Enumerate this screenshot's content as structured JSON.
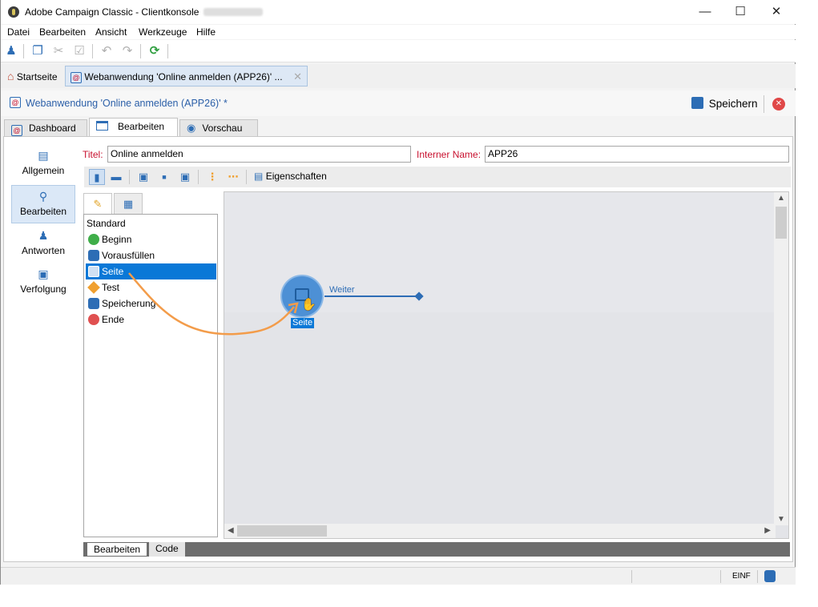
{
  "window": {
    "title": "Adobe Campaign Classic - Clientkonsole"
  },
  "menu": [
    "Datei",
    "Bearbeiten",
    "Ansicht",
    "Werkzeuge",
    "Hilfe"
  ],
  "doc_tabs": {
    "home": "Startseite",
    "webapp": "Webanwendung 'Online anmelden (APP26)' ..."
  },
  "doc_header": {
    "title": "Webanwendung 'Online anmelden (APP26)' *",
    "save_label": "Speichern"
  },
  "sub_tabs": [
    "Dashboard",
    "Bearbeiten",
    "Vorschau"
  ],
  "sidenav": [
    {
      "label": "Allgemein",
      "icon": "clipboard-icon"
    },
    {
      "label": "Bearbeiten",
      "icon": "edit-page-icon"
    },
    {
      "label": "Antworten",
      "icon": "user-mail-icon"
    },
    {
      "label": "Verfolgung",
      "icon": "tracking-icon"
    }
  ],
  "form": {
    "title_label": "Titel:",
    "title_value": "Online anmelden",
    "internal_name_label": "Interner Name:",
    "internal_name_value": "APP26"
  },
  "editor_toolbar": {
    "properties_label": "Eigenschaften"
  },
  "palette": {
    "header": "Standard",
    "items": [
      {
        "label": "Beginn",
        "icon": "play-icon",
        "color": "#3fae49"
      },
      {
        "label": "Vorausfüllen",
        "icon": "database-icon",
        "color": "#2d6db5"
      },
      {
        "label": "Seite",
        "icon": "page-icon",
        "color": "#2d6db5"
      },
      {
        "label": "Test",
        "icon": "diamond-icon",
        "color": "#f0a030"
      },
      {
        "label": "Speicherung",
        "icon": "database-save-icon",
        "color": "#2d6db5"
      },
      {
        "label": "Ende",
        "icon": "stop-icon",
        "color": "#e05050"
      }
    ]
  },
  "workflow": {
    "node_label": "Seite",
    "transition_label": "Weiter"
  },
  "bottom_tabs": [
    "Bearbeiten",
    "Code"
  ],
  "status": {
    "mode": "EINF"
  }
}
